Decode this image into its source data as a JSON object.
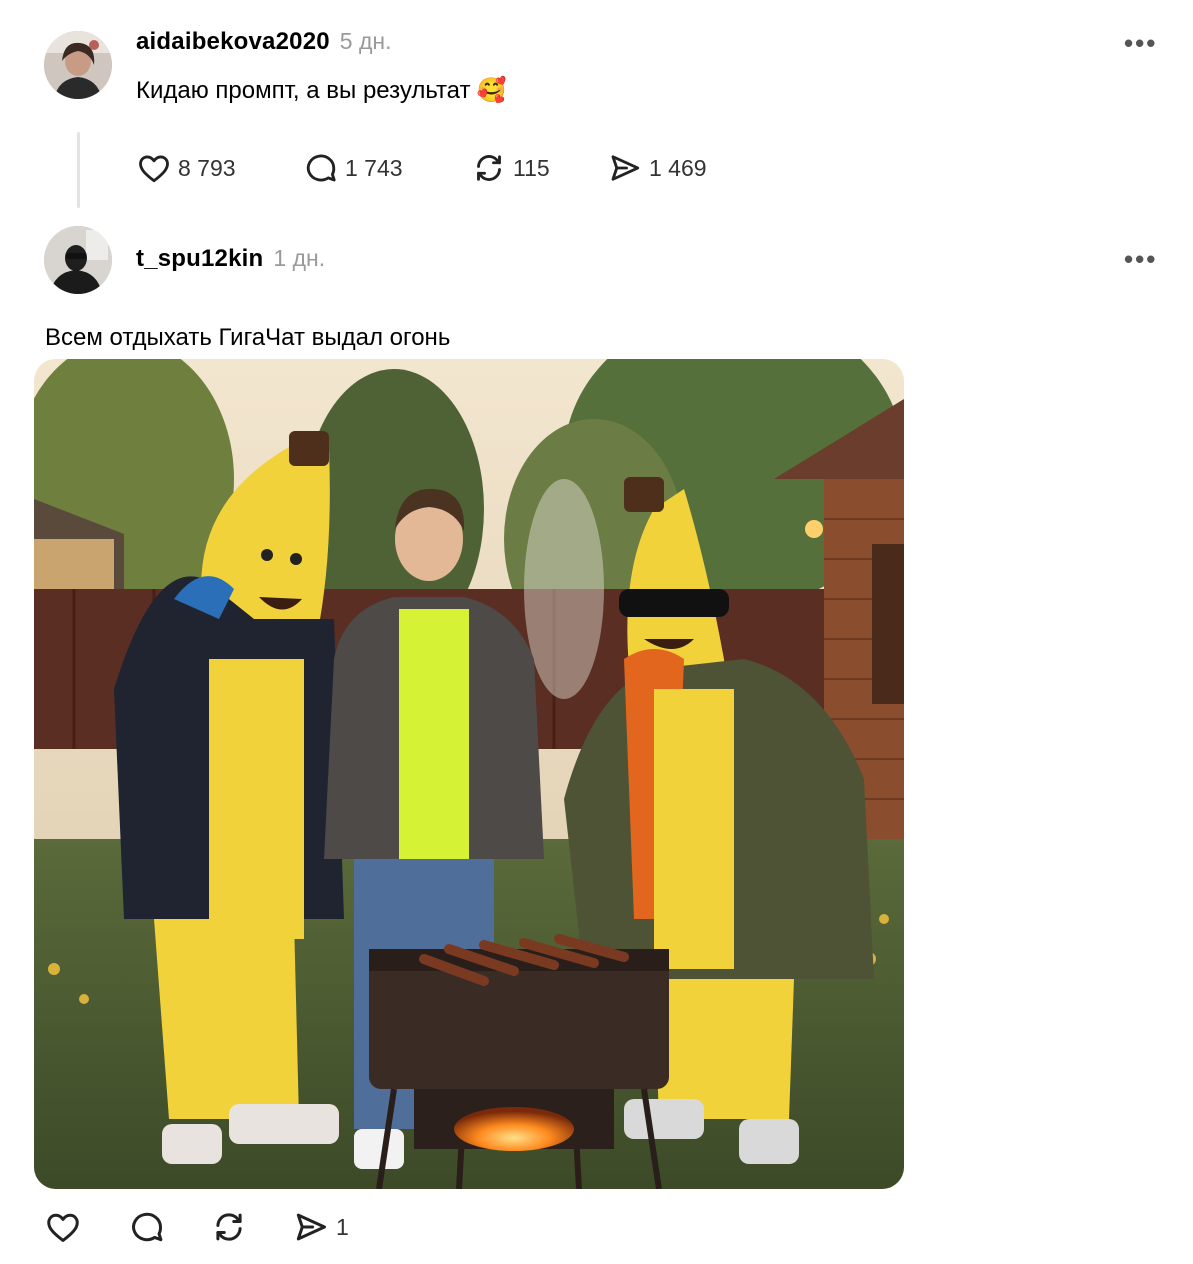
{
  "posts": [
    {
      "username": "aidaibekova2020",
      "time": "5 дн.",
      "text": "Кидаю промпт, а вы результат",
      "emoji": "🥰",
      "more_label": "•••",
      "stats": {
        "likes": "8 793",
        "comments": "1 743",
        "reposts": "115",
        "shares": "1 469"
      }
    },
    {
      "username": "t_spu12kin",
      "time": "1 дн.",
      "text": "Всем отдыхать ГигаЧат выдал огонь",
      "more_label": "•••",
      "image_alt": "photo",
      "stats": {
        "likes": "",
        "comments": "",
        "reposts": "",
        "shares": "1"
      }
    }
  ],
  "icons": [
    "heart-icon",
    "comment-icon",
    "repost-icon",
    "share-icon",
    "more-icon"
  ],
  "colors": {
    "text": "#000000",
    "muted": "#9a9a9a",
    "icon": "#333333",
    "thread_line": "#e3e3e3"
  }
}
